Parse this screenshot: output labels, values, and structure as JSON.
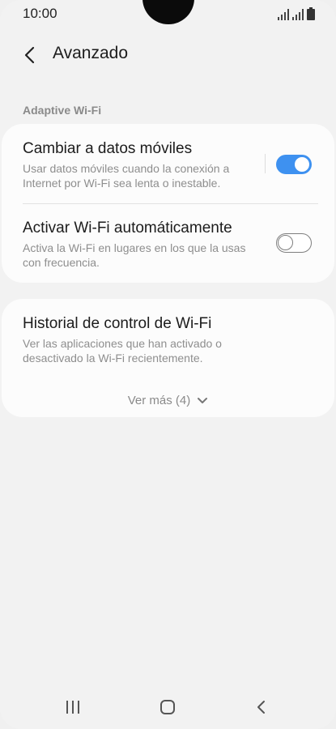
{
  "status_bar": {
    "time": "10:00"
  },
  "header": {
    "title": "Avanzado"
  },
  "section": {
    "label": "Adaptive Wi-Fi"
  },
  "settings": [
    {
      "title": "Cambiar a datos móviles",
      "description": "Usar datos móviles cuando la conexión a Internet por Wi-Fi sea lenta o inestable.",
      "enabled": true
    },
    {
      "title": "Activar Wi-Fi automáticamente",
      "description": "Activa la Wi-Fi en lugares en los que la usas con frecuencia.",
      "enabled": false
    }
  ],
  "history": {
    "title": "Historial de control de Wi-Fi",
    "description": "Ver las aplicaciones que han activado o desactivado la Wi-Fi recientemente.",
    "see_more": "Ver más (4)"
  },
  "colors": {
    "accent": "#3e91f0",
    "background": "#f2f2f2",
    "card": "#fcfcfc",
    "secondary_text": "#8e8e8e"
  },
  "icons": {
    "back": "chevron-left-icon",
    "expand": "chevron-down-icon",
    "signal": "signal-bars-icon",
    "battery": "battery-icon",
    "nav_recents": "recent-apps-icon",
    "nav_home": "home-icon",
    "nav_back": "back-icon"
  }
}
